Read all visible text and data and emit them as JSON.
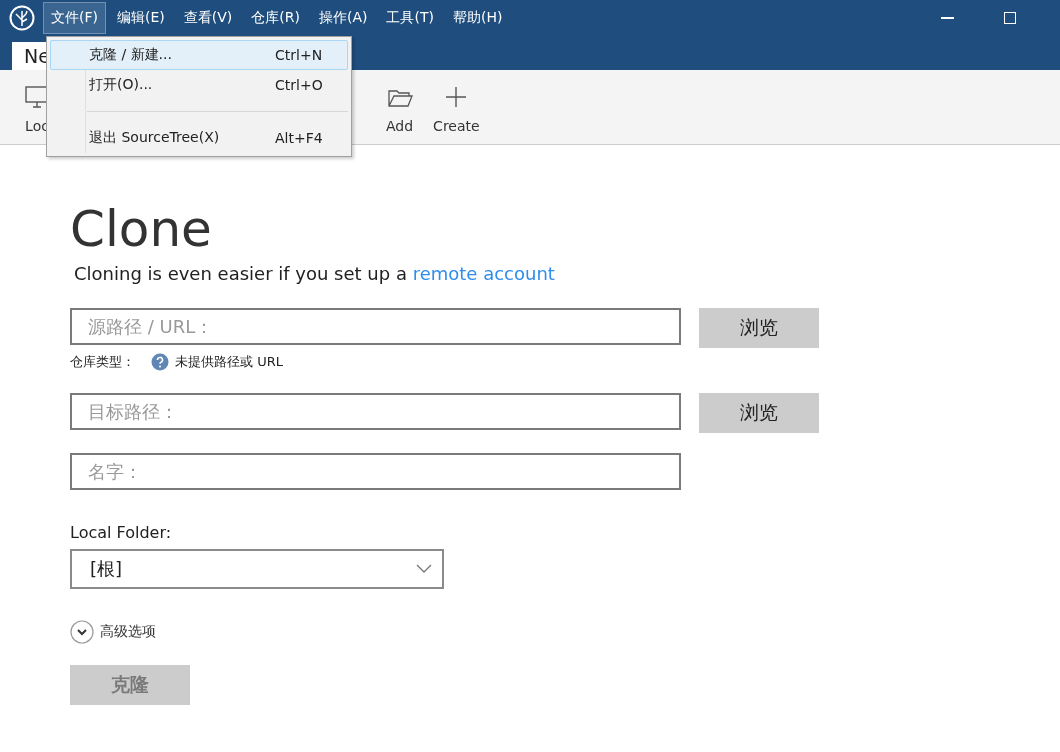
{
  "menubar": [
    {
      "label": "文件(F)",
      "selected": true
    },
    {
      "label": "编辑(E)",
      "selected": false
    },
    {
      "label": "查看(V)",
      "selected": false
    },
    {
      "label": "仓库(R)",
      "selected": false
    },
    {
      "label": "操作(A)",
      "selected": false
    },
    {
      "label": "工具(T)",
      "selected": false
    },
    {
      "label": "帮助(H)",
      "selected": false
    }
  ],
  "tabs": [
    {
      "label": "Ne",
      "selected": true
    }
  ],
  "toolbar": [
    {
      "label": "Loc",
      "kind": "monitor"
    },
    {
      "label": "Add",
      "kind": "folder"
    },
    {
      "label": "Create",
      "kind": "plus"
    }
  ],
  "menu": [
    {
      "kind": "item",
      "label": "克隆 / 新建...",
      "shortcut": "Ctrl+N",
      "selected": true
    },
    {
      "kind": "item",
      "label": "打开(O)...",
      "shortcut": "Ctrl+O",
      "selected": false
    },
    {
      "kind": "separator"
    },
    {
      "kind": "item",
      "label": "退出 SourceTree(X)",
      "shortcut": "Alt+F4",
      "selected": false
    }
  ],
  "clone": {
    "title": "Clone",
    "subtitle": "Cloning is even easier if you set up a ",
    "subtitle_link": "remote account",
    "source": {
      "placeholder": "源路径 / URL：",
      "button": "浏览"
    },
    "repo_type": {
      "label": "仓库类型：",
      "value": "未提供路径或 URL"
    },
    "destination": {
      "placeholder": "目标路径：",
      "button": "浏览"
    },
    "name": {
      "placeholder": "名字："
    },
    "local_folder": {
      "label": "Local Folder:",
      "value": "[根]"
    },
    "advanced": {
      "label": "高级选项",
      "expanded": false
    },
    "submit": {
      "label": "克隆",
      "disabled": true
    }
  }
}
